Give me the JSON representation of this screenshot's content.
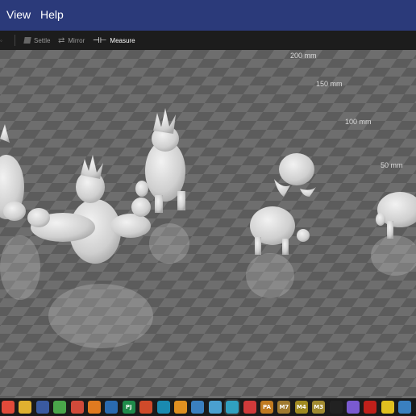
{
  "menu": {
    "items": [
      "View",
      "Help"
    ]
  },
  "toolbar": {
    "settle": "Settle",
    "mirror": "Mirror",
    "measure": "Measure"
  },
  "rulers": [
    "200 mm",
    "150 mm",
    "100 mm",
    "50 mm"
  ],
  "taskbar": {
    "icons": [
      {
        "name": "app-icon-1",
        "label": "",
        "color": "#e04a3a"
      },
      {
        "name": "app-icon-2",
        "label": "",
        "color": "#e0b030"
      },
      {
        "name": "app-icon-3",
        "label": "",
        "color": "#3a5aa0"
      },
      {
        "name": "chrome-icon",
        "label": "",
        "color": "#4aa64a"
      },
      {
        "name": "chrome-icon-2",
        "label": "",
        "color": "#d04a3a"
      },
      {
        "name": "firefox-icon",
        "label": "",
        "color": "#e07a20"
      },
      {
        "name": "app-icon-7",
        "label": "",
        "color": "#2a6ab0"
      },
      {
        "name": "app-icon-8",
        "label": "PJ",
        "color": "#1f8a4a"
      },
      {
        "name": "app-icon-9",
        "label": "",
        "color": "#d04a2a"
      },
      {
        "name": "edge-icon",
        "label": "",
        "color": "#1a8ab0"
      },
      {
        "name": "app-icon-11",
        "label": "",
        "color": "#e09020"
      },
      {
        "name": "app-icon-12",
        "label": "",
        "color": "#3a80c0"
      },
      {
        "name": "app-icon-13",
        "label": "",
        "color": "#4aa0d0"
      },
      {
        "name": "app-icon-14",
        "label": "",
        "color": "#30a0c0"
      },
      {
        "name": "app-icon-15",
        "label": "",
        "color": "#d03a3a"
      },
      {
        "name": "app-icon-16",
        "label": "PA",
        "color": "#c07a20"
      },
      {
        "name": "app-icon-17",
        "label": "M7",
        "color": "#a07a30"
      },
      {
        "name": "app-icon-18",
        "label": "M4",
        "color": "#a08a20"
      },
      {
        "name": "app-icon-19",
        "label": "M3",
        "color": "#a08a30"
      },
      {
        "name": "capcut-icon",
        "label": "",
        "color": "#222222"
      },
      {
        "name": "app-icon-21",
        "label": "",
        "color": "#7a5ad0"
      },
      {
        "name": "acrobat-icon",
        "label": "",
        "color": "#c0201a"
      },
      {
        "name": "app-icon-23",
        "label": "",
        "color": "#e0c020"
      },
      {
        "name": "app-icon-24",
        "label": "",
        "color": "#3a80c0"
      }
    ]
  }
}
